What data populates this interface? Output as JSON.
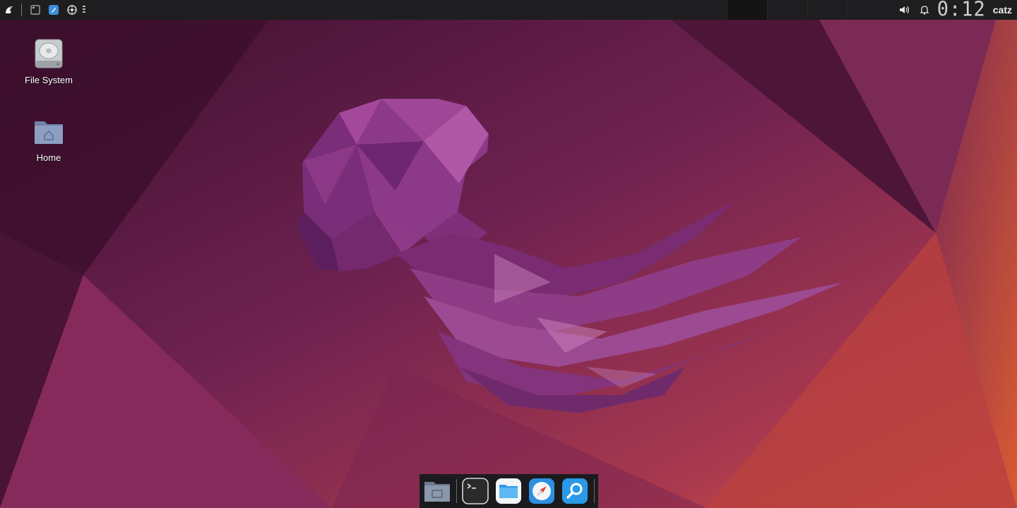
{
  "top_panel": {
    "launchers": [
      {
        "icon": "distro-menu-icon"
      },
      {
        "icon": "show-desktop-icon"
      },
      {
        "icon": "app-launcher-icon"
      },
      {
        "icon": "settings-icon"
      }
    ],
    "tray": {
      "volume_icon": "volume-icon",
      "notifications_icon": "bell-icon",
      "clock": "0:12",
      "user": "catz"
    }
  },
  "desktop": {
    "icons": [
      {
        "label": "File System",
        "icon": "drive-icon"
      },
      {
        "label": "Home",
        "icon": "home-folder-icon"
      }
    ]
  },
  "dock": {
    "items": [
      {
        "icon": "show-desktop-icon"
      },
      {
        "icon": "terminal-icon"
      },
      {
        "icon": "file-manager-icon"
      },
      {
        "icon": "web-browser-icon"
      },
      {
        "icon": "search-icon"
      }
    ]
  },
  "colors": {
    "panel": "#1e1e20",
    "wallpaper_dark": "#4a1433",
    "wallpaper_accent": "#d25a35",
    "jellyfish": "#9a3f93"
  }
}
